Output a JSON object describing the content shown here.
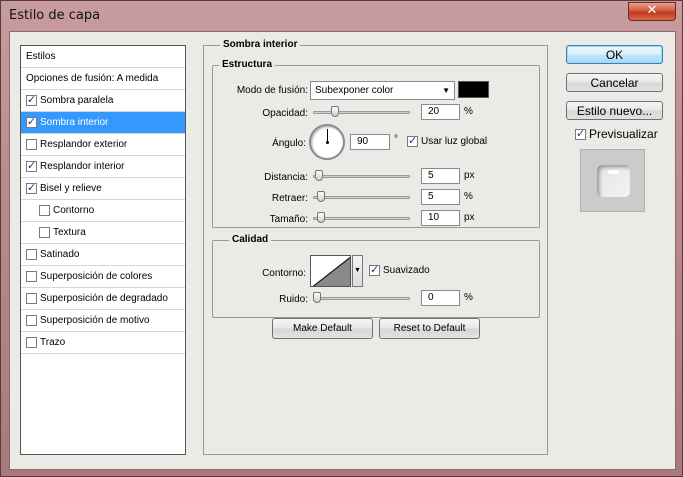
{
  "window": {
    "title": "Estilo de capa",
    "close_glyph": "✕"
  },
  "styles_list": {
    "header": "Estilos",
    "blend_options": "Opciones de fusión: A medida",
    "items": [
      {
        "label": "Sombra paralela",
        "checked": true
      },
      {
        "label": "Sombra interior",
        "checked": true,
        "selected": true
      },
      {
        "label": "Resplandor exterior",
        "checked": false
      },
      {
        "label": "Resplandor interior",
        "checked": true
      },
      {
        "label": "Bisel y relieve",
        "checked": true
      },
      {
        "label": "Contorno",
        "checked": false,
        "indent": true
      },
      {
        "label": "Textura",
        "checked": false,
        "indent": true
      },
      {
        "label": "Satinado",
        "checked": false
      },
      {
        "label": "Superposición de colores",
        "checked": false
      },
      {
        "label": "Superposición de degradado",
        "checked": false
      },
      {
        "label": "Superposición de motivo",
        "checked": false
      },
      {
        "label": "Trazo",
        "checked": false
      }
    ]
  },
  "panel": {
    "title": "Sombra interior",
    "structure": {
      "title": "Estructura",
      "blend_mode_label": "Modo de fusión:",
      "blend_mode_value": "Subexponer color",
      "shadow_color": "#000000",
      "opacity_label": "Opacidad:",
      "opacity_value": "20",
      "opacity_unit": "%",
      "opacity_fraction": 0.2,
      "angle_label": "Ángulo:",
      "angle_value": "90",
      "angle_unit": "°",
      "global_light_label": "Usar luz global",
      "global_light_checked": true,
      "distance_label": "Distancia:",
      "distance_value": "5",
      "distance_unit": "px",
      "choke_label": "Retraer:",
      "choke_value": "5",
      "choke_unit": "%",
      "size_label": "Tamaño:",
      "size_value": "10",
      "size_unit": "px"
    },
    "quality": {
      "title": "Calidad",
      "contour_label": "Contorno:",
      "antialias_label": "Suavizado",
      "antialias_checked": true,
      "noise_label": "Ruido:",
      "noise_value": "0",
      "noise_unit": "%"
    },
    "make_default": "Make Default",
    "reset_default": "Reset to Default"
  },
  "actions": {
    "ok": "OK",
    "cancel": "Cancelar",
    "new_style": "Estilo nuevo...",
    "preview_label": "Previsualizar",
    "preview_checked": true
  }
}
